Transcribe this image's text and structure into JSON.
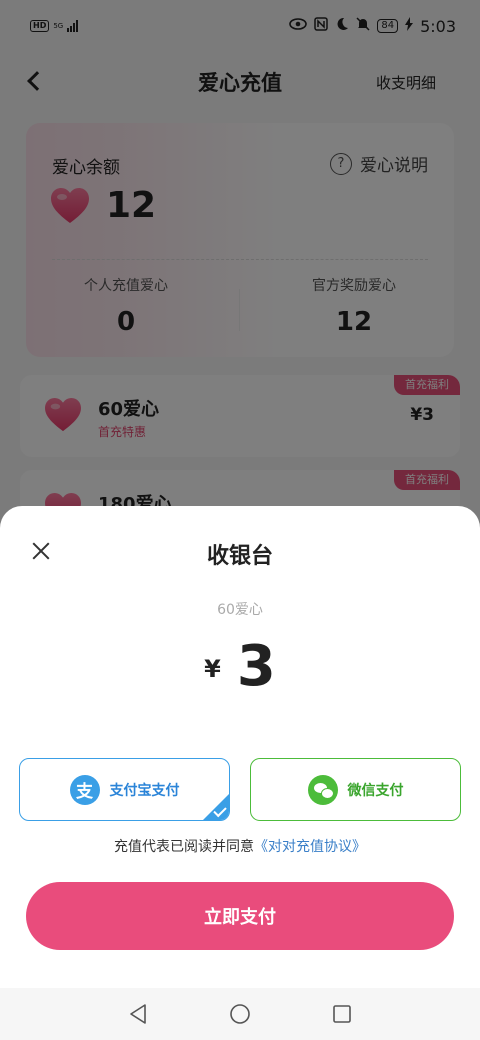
{
  "status_bar": {
    "hd": "HD",
    "network": "5G",
    "battery": "84",
    "time": "5:03"
  },
  "header": {
    "title": "爱心充值",
    "records": "收支明细"
  },
  "balance": {
    "label": "爱心余额",
    "help": "爱心说明",
    "help_symbol": "?",
    "value": "12",
    "personal_label": "个人充值爱心",
    "personal_value": "0",
    "official_label": "官方奖励爱心",
    "official_value": "12"
  },
  "packages": [
    {
      "name": "60爱心",
      "tag": "首充特惠",
      "price": "¥3",
      "badge": "首充福利"
    },
    {
      "name": "180爱心",
      "badge": "首充福利"
    }
  ],
  "checkout": {
    "title": "收银台",
    "product": "60爱心",
    "currency": "¥",
    "amount": "3",
    "alipay": "支付宝支付",
    "alipay_symbol": "支",
    "wechat": "微信支付",
    "agreement_text": "充值代表已阅读并同意",
    "agreement_link": "《对对充值协议》",
    "pay_button": "立即支付"
  },
  "colors": {
    "accent": "#e94c7c",
    "alipay": "#3a9fe6",
    "wechat": "#4cbc3a"
  },
  "icons": [
    "back-icon",
    "help-icon",
    "heart-icon",
    "close-icon",
    "alipay-icon",
    "wechat-icon",
    "check-icon",
    "nav-back-icon",
    "nav-home-icon",
    "nav-recent-icon"
  ]
}
